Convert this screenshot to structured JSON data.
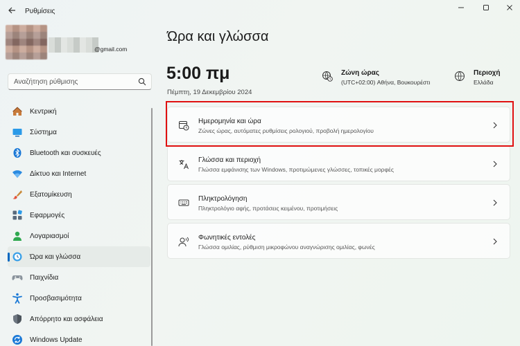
{
  "window": {
    "title": "Ρυθμίσεις",
    "controls": [
      "minimize-icon",
      "maximize-icon",
      "close-icon"
    ]
  },
  "profile": {
    "email_domain": "@gmail.com"
  },
  "search": {
    "placeholder": "Αναζήτηση ρύθμισης"
  },
  "sidebar": {
    "items": [
      {
        "label": "Κεντρική",
        "icon": "home-icon",
        "active": false
      },
      {
        "label": "Σύστημα",
        "icon": "system-icon",
        "active": false
      },
      {
        "label": "Bluetooth και συσκευές",
        "icon": "bluetooth-icon",
        "active": false
      },
      {
        "label": "Δίκτυο και Internet",
        "icon": "wifi-icon",
        "active": false
      },
      {
        "label": "Εξατομίκευση",
        "icon": "brush-icon",
        "active": false
      },
      {
        "label": "Εφαρμογές",
        "icon": "apps-icon",
        "active": false
      },
      {
        "label": "Λογαριασμοί",
        "icon": "account-icon",
        "active": false
      },
      {
        "label": "Ώρα και γλώσσα",
        "icon": "globe-clock-icon",
        "active": true
      },
      {
        "label": "Παιχνίδια",
        "icon": "gamepad-icon",
        "active": false
      },
      {
        "label": "Προσβασιμότητα",
        "icon": "accessibility-icon",
        "active": false
      },
      {
        "label": "Απόρρητο και ασφάλεια",
        "icon": "shield-icon",
        "active": false
      },
      {
        "label": "Windows Update",
        "icon": "update-icon",
        "active": false
      }
    ]
  },
  "main": {
    "title": "Ώρα και γλώσσα",
    "time": "5:00 πμ",
    "date": "Πέμπτη, 19 Δεκεμβρίου 2024",
    "timezone": {
      "title": "Ζώνη ώρας",
      "value": "(UTC+02:00) Αθήνα, Βουκουρέστι"
    },
    "region": {
      "title": "Περιοχή",
      "value": "Ελλάδα"
    },
    "cards": [
      {
        "title": "Ημερομηνία και ώρα",
        "subtitle": "Ζώνες ώρας, αυτόματες ρυθμίσεις ρολογιού, προβολή ημερολογίου",
        "icon": "calendar-clock-icon"
      },
      {
        "title": "Γλώσσα και περιοχή",
        "subtitle": "Γλώσσα εμφάνισης των Windows, προτιμώμενες γλώσσες, τοπικές μορφές",
        "icon": "language-icon"
      },
      {
        "title": "Πληκτρολόγηση",
        "subtitle": "Πληκτρολόγιο αφής, προτάσεις κειμένου, προτιμήσεις",
        "icon": "keyboard-icon"
      },
      {
        "title": "Φωνητικές εντολές",
        "subtitle": "Γλώσσα ομιλίας, ρύθμιση μικροφώνου αναγνώρισης ομιλίας, φωνές",
        "icon": "speech-icon"
      }
    ]
  },
  "colors": {
    "accent": "#0067c0",
    "highlight": "#e01010"
  }
}
